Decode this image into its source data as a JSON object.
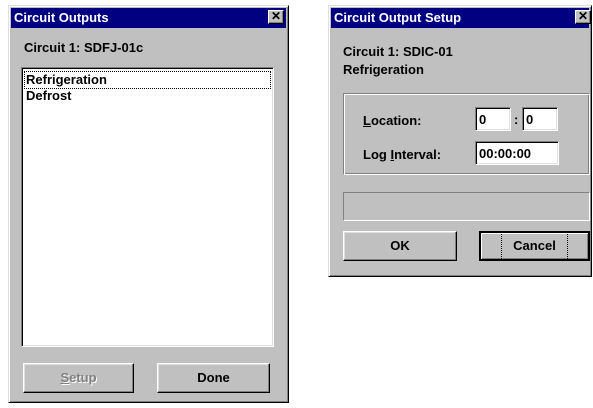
{
  "circuit_outputs": {
    "title": "Circuit Outputs",
    "close_glyph": "✕",
    "circuit_label": "Circuit 1: SDFJ-01c",
    "outputs": [
      "Refrigeration",
      "Defrost"
    ],
    "setup_button": {
      "mnemonic": "S",
      "rest": "etup",
      "enabled": false
    },
    "done_button": "Done"
  },
  "circuit_output_setup": {
    "title": "Circuit Output Setup",
    "close_glyph": "✕",
    "circuit_label": "Circuit 1: SDIC-01",
    "output_name": "Refrigeration",
    "location_label": {
      "mnemonic": "L",
      "rest": "ocation:"
    },
    "location_value_1": "0",
    "location_separator": ":",
    "location_value_2": "0",
    "log_interval_label": {
      "before": "Log ",
      "mnemonic": "I",
      "rest": "nterval:"
    },
    "log_interval_value": "00:00:00",
    "status_text": "",
    "ok_button": "OK",
    "cancel_button": "Cancel"
  }
}
